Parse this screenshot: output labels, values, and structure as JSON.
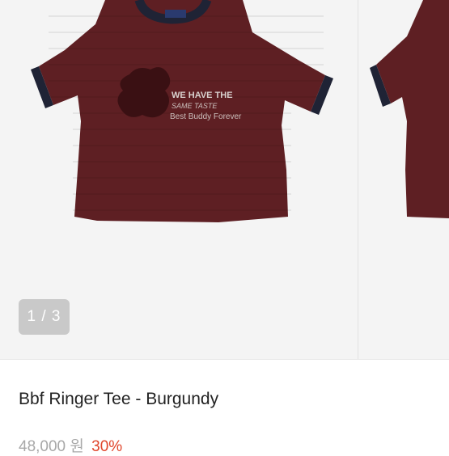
{
  "gallery": {
    "counter": "1 / 3",
    "print_lines": [
      "WE HAVE THE",
      "SAME TASTE",
      "Best Buddy Forever"
    ]
  },
  "product": {
    "title": "Bbf Ringer Tee - Burgundy",
    "original_price": "48,000 원",
    "discount": "30%"
  },
  "colors": {
    "shirt": "#5e1f23",
    "trim": "#1f2335",
    "discount": "#e0452b"
  }
}
